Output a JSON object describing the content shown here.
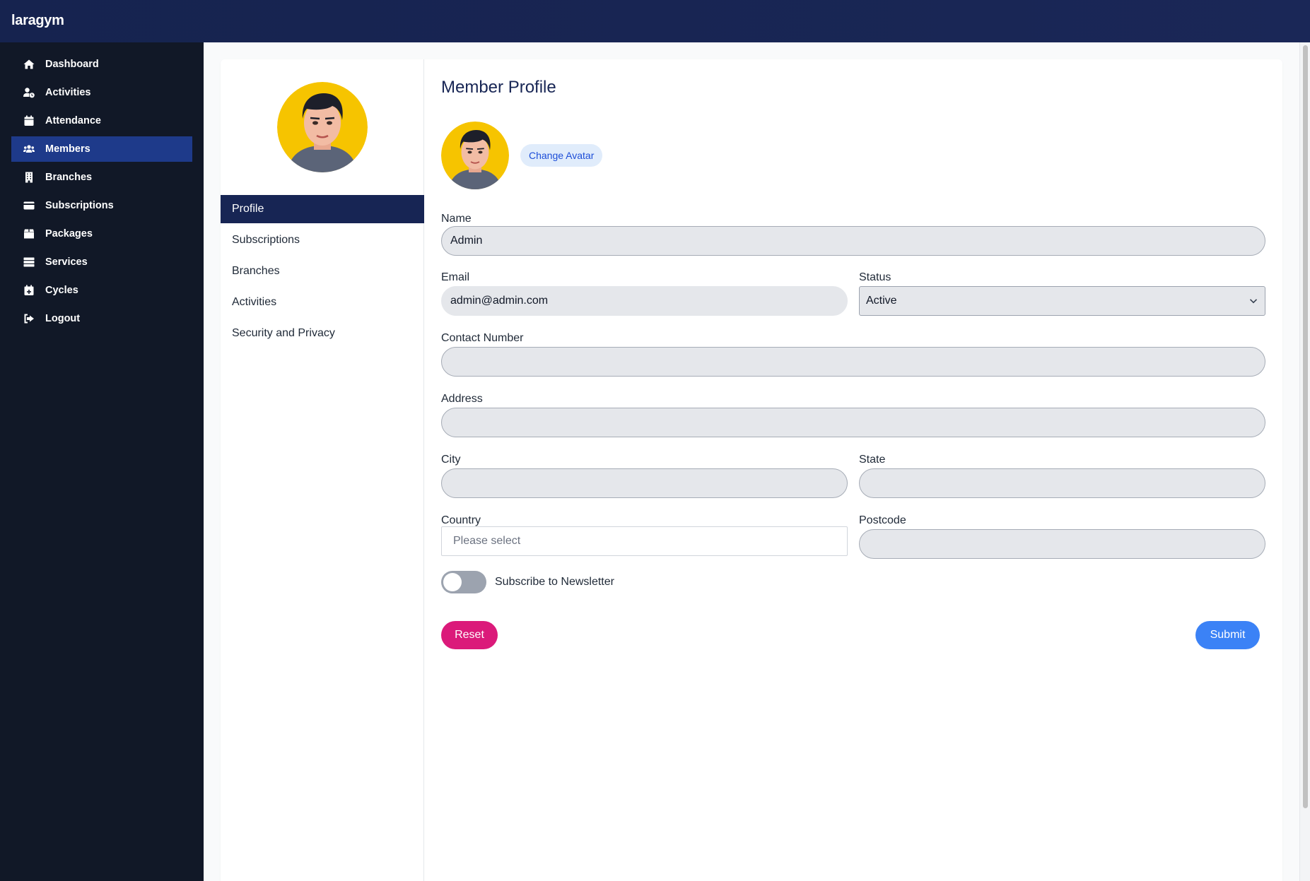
{
  "app": {
    "brand": "laragym"
  },
  "sidebar": {
    "items": [
      {
        "label": "Dashboard",
        "icon": "home-icon"
      },
      {
        "label": "Activities",
        "icon": "user-clock-icon"
      },
      {
        "label": "Attendance",
        "icon": "calendar-icon"
      },
      {
        "label": "Members",
        "icon": "users-icon",
        "active": true
      },
      {
        "label": "Branches",
        "icon": "building-icon"
      },
      {
        "label": "Subscriptions",
        "icon": "credit-card-icon"
      },
      {
        "label": "Packages",
        "icon": "box-icon"
      },
      {
        "label": "Services",
        "icon": "server-icon"
      },
      {
        "label": "Cycles",
        "icon": "calendar-plus-icon"
      },
      {
        "label": "Logout",
        "icon": "sign-out-icon"
      }
    ]
  },
  "profile_tabs": [
    {
      "label": "Profile",
      "active": true
    },
    {
      "label": "Subscriptions"
    },
    {
      "label": "Branches"
    },
    {
      "label": "Activities"
    },
    {
      "label": "Security and Privacy"
    }
  ],
  "form": {
    "title": "Member Profile",
    "change_avatar_label": "Change Avatar",
    "name": {
      "label": "Name",
      "value": "Admin"
    },
    "email": {
      "label": "Email",
      "value": "admin@admin.com"
    },
    "status": {
      "label": "Status",
      "value": "Active"
    },
    "contact": {
      "label": "Contact Number",
      "value": ""
    },
    "address": {
      "label": "Address",
      "value": ""
    },
    "city": {
      "label": "City",
      "value": ""
    },
    "state": {
      "label": "State",
      "value": ""
    },
    "country": {
      "label": "Country",
      "placeholder": "Please select"
    },
    "postcode": {
      "label": "Postcode",
      "value": ""
    },
    "newsletter": {
      "label": "Subscribe to Newsletter",
      "enabled": false
    },
    "reset_label": "Reset",
    "submit_label": "Submit"
  },
  "colors": {
    "topbar": "#172554",
    "sidebar": "#111827",
    "sidebar_active": "#1e3a8a",
    "tab_active": "#172554",
    "reset": "#db1a7a",
    "submit": "#3b82f6",
    "avatar_background": "#f6c400"
  }
}
